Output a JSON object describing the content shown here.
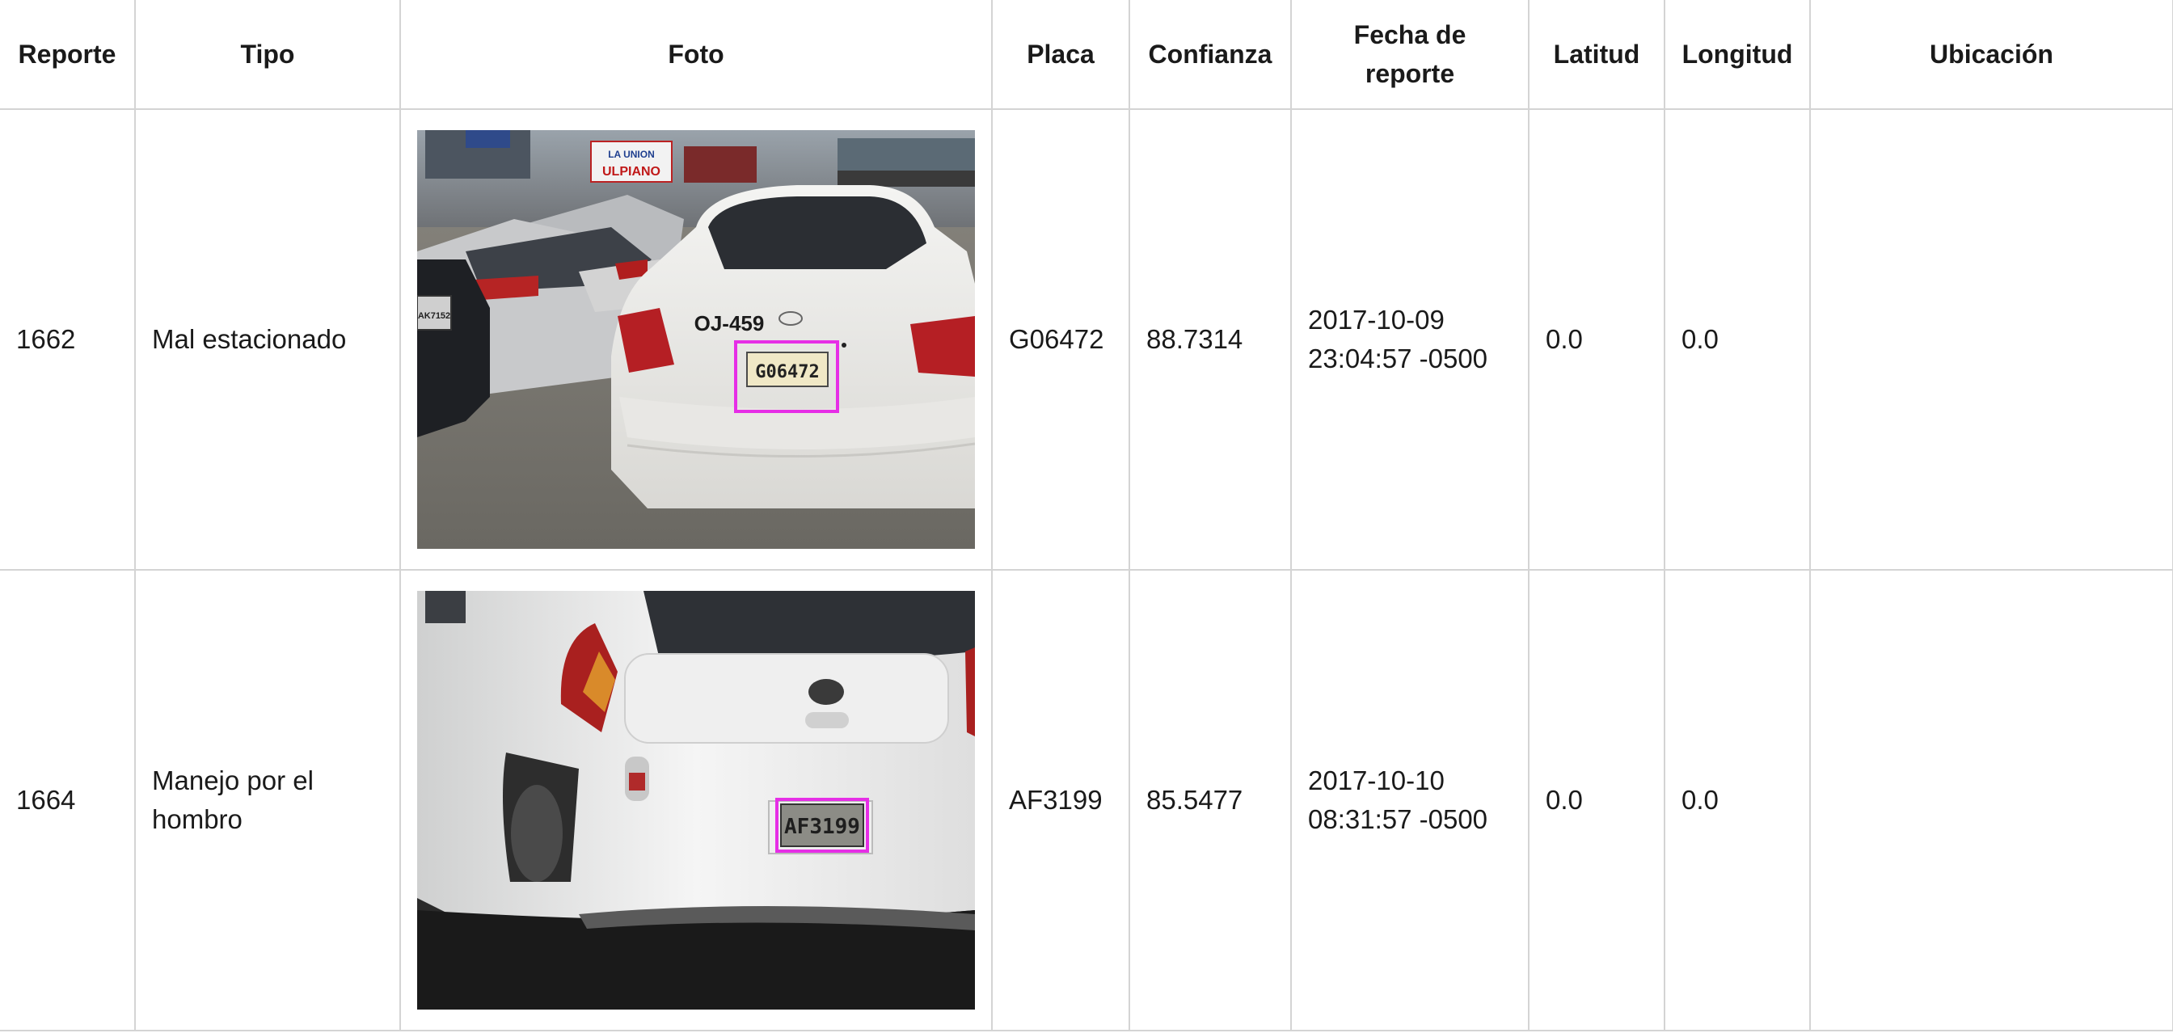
{
  "table": {
    "headers": {
      "reporte": "Reporte",
      "tipo": "Tipo",
      "foto": "Foto",
      "placa": "Placa",
      "confianza": "Confianza",
      "fecha_line1": "Fecha de",
      "fecha_line2": "reporte",
      "latitud": "Latitud",
      "longitud": "Longitud",
      "ubicacion": "Ubicación"
    },
    "rows": [
      {
        "reporte": "1662",
        "tipo": "Mal estacionado",
        "placa": "G06472",
        "confianza": "88.7314",
        "fecha_date": "2017-10-09",
        "fecha_time": "23:04:57 -0500",
        "latitud": "0.0",
        "longitud": "0.0",
        "ubicacion": "",
        "photo": {
          "trunk_text": "OJ-459",
          "plate_text": "G06472",
          "banner_text_1": "LA UNION",
          "banner_text_2": "ULPIANO",
          "left_plate_text": "AK7152"
        }
      },
      {
        "reporte": "1664",
        "tipo_line1": "Manejo por el",
        "tipo_line2": "hombro",
        "placa": "AF3199",
        "confianza": "85.5477",
        "fecha_date": "2017-10-10",
        "fecha_time": "08:31:57 -0500",
        "latitud": "0.0",
        "longitud": "0.0",
        "ubicacion": "",
        "photo": {
          "plate_text": "AF3199"
        }
      }
    ]
  },
  "colors": {
    "detection_box": "#e62ee6",
    "grid_border": "#d4d4d4",
    "text": "#1a1a1a"
  }
}
